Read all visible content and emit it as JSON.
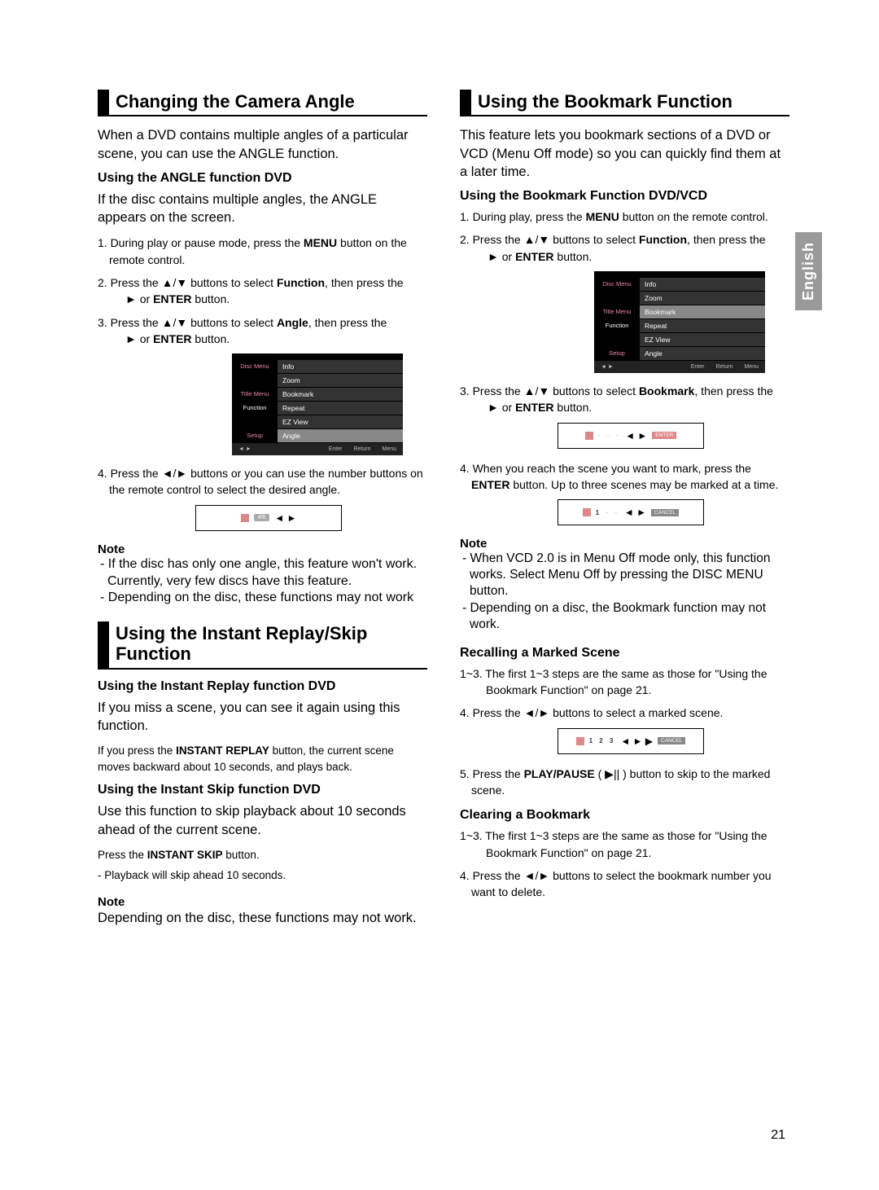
{
  "language_tab": "English",
  "page_number": "21",
  "left": {
    "h1": "Changing the Camera Angle",
    "intro": "When a DVD contains multiple angles of a particular scene, you can use the ANGLE function.",
    "sub1": "Using the ANGLE function DVD",
    "sub1_text": "If the disc contains multiple angles, the ANGLE appears on the screen.",
    "step1_a": "1. During play or pause mode, press the ",
    "step1_b": "MENU",
    "step1_c": " button on the remote control.",
    "step2_a": "2. Press the ▲/▼ buttons to select ",
    "step2_b": "Function",
    "step2_c": ", then press the",
    "step2_d": "► or ",
    "step2_e": "ENTER",
    "step2_f": "  button.",
    "step3_a": "3. Press the ▲/▼ buttons to select ",
    "step3_b": "Angle",
    "step3_c": ", then press the",
    "step3_d": "► or ",
    "step3_e": "ENTER",
    "step3_f": " button.",
    "osd": {
      "left": [
        "Disc Menu",
        "Title Menu",
        "Function",
        "Setup"
      ],
      "right": [
        "Info",
        "Zoom",
        "Bookmark",
        "Repeat",
        "EZ View",
        "Angle"
      ],
      "hl": "Angle",
      "foot": [
        "◄ ►",
        "Enter",
        "Return",
        "Menu"
      ]
    },
    "step4": "4. Press the ◄/► buttons or you can use the number buttons on the remote control to select the desired angle.",
    "osd2_badge": "4/6",
    "note_head": "Note",
    "note1": "- If the disc has only one angle, this feature won't work. Currently, very few discs have this feature.",
    "note2": "- Depending on the disc, these functions may not work",
    "h2": "Using the Instant Replay/Skip Function",
    "sub2": "Using the Instant Replay function DVD",
    "sub2_text": "If you miss a scene, you can see it again using this function.",
    "sub2_step_a": "If you press the ",
    "sub2_step_b": "INSTANT REPLAY",
    "sub2_step_c": " button, the current scene moves backward about 10 seconds, and plays back.",
    "sub3": "Using the Instant Skip function DVD",
    "sub3_text": "Use this function to skip playback about 10 seconds ahead of the current scene.",
    "sub3_step_a": "Press the ",
    "sub3_step_b": "INSTANT SKIP",
    "sub3_step_c": " button.",
    "sub3_bullet": "- Playback will skip ahead 10 seconds.",
    "note2_head": "Note",
    "note2_text": "Depending on the disc, these functions may not work."
  },
  "right": {
    "h1": "Using the Bookmark Function",
    "intro": "This feature lets you bookmark sections of a DVD or VCD (Menu Off mode) so you can quickly find them at a later time.",
    "sub1": "Using the Bookmark Function DVD/VCD",
    "step1_a": "1. During play, press the ",
    "step1_b": "MENU",
    "step1_c": " button on the remote control.",
    "step2_a": "2. Press the ▲/▼ buttons to select ",
    "step2_b": "Function",
    "step2_c": ", then  press the",
    "step2_d": "► or ",
    "step2_e": "ENTER",
    "step2_f": " button.",
    "osd": {
      "left": [
        "Disc Menu",
        "Title Menu",
        "Function",
        "Setup"
      ],
      "right": [
        "Info",
        "Zoom",
        "Bookmark",
        "Repeat",
        "EZ View",
        "Angle"
      ],
      "hl": "Bookmark",
      "foot": [
        "◄ ►",
        "Enter",
        "Return",
        "Menu"
      ]
    },
    "step3_a": "3. Press the ▲/▼ buttons to select ",
    "step3_b": "Bookmark",
    "step3_c": ", then press the",
    "step3_d": "► or ",
    "step3_e": "ENTER",
    "step3_f": " button.",
    "osd3_btn": "ENTER",
    "step4_a": "4. When you reach the scene you want to mark, press the ",
    "step4_b": "ENTER",
    "step4_c": " button. Up to three scenes may be marked at a time.",
    "osd4_num": "1",
    "osd4_btn": "CANCEL",
    "note_head": "Note",
    "note1": "- When VCD 2.0 is in Menu Off mode only, this function works. Select Menu Off by pressing the DISC MENU button.",
    "note2": "- Depending on a disc, the Bookmark function may not work.",
    "sub2": "Recalling a Marked Scene",
    "r_step13": "1~3. The first 1~3 steps are the same as those for \"Using the Bookmark Function\" on page 21.",
    "r_step4": "4.  Press the ◄/► buttons to select a marked scene.",
    "osd5_nums": "1  2  3",
    "osd5_btn": "CANCEL",
    "r_step5_a": "5. Press the ",
    "r_step5_b": "PLAY/PAUSE",
    "r_step5_c": " ( ▶|| ) button to skip to the marked scene.",
    "sub3": "Clearing a Bookmark",
    "c_step13": "1~3. The first 1~3 steps are the same as those for  \"Using the Bookmark Function\" on page 21.",
    "c_step4": "4. Press the ◄/► buttons to select the bookmark number you want to delete."
  }
}
